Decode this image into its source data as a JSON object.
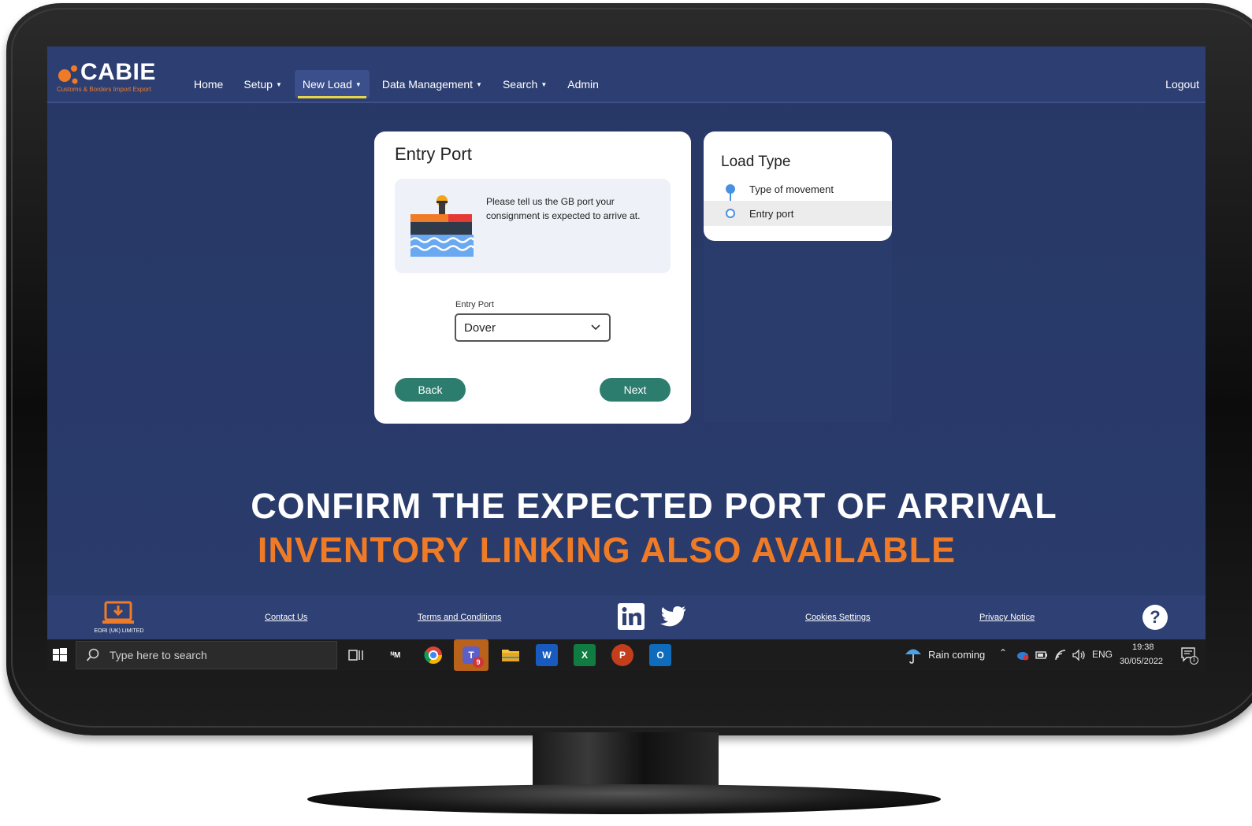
{
  "brand": {
    "name": "CABIE",
    "tagline": "Customs & Borders Import Export",
    "accent": "#f07b27"
  },
  "nav": {
    "items": [
      {
        "label": "Home",
        "has_caret": false
      },
      {
        "label": "Setup",
        "has_caret": true
      },
      {
        "label": "New Load",
        "has_caret": true,
        "active": true
      },
      {
        "label": "Data Management",
        "has_caret": true
      },
      {
        "label": "Search",
        "has_caret": true
      },
      {
        "label": "Admin",
        "has_caret": false
      }
    ],
    "logout": "Logout"
  },
  "entry_card": {
    "title": "Entry Port",
    "info": "Please tell us the GB port your consignment is expected to arrive at.",
    "field_label": "Entry Port",
    "selected_port": "Dover",
    "back_label": "Back",
    "next_label": "Next",
    "button_color": "#2d7d6e"
  },
  "load_type": {
    "title": "Load Type",
    "steps": [
      {
        "label": "Type of movement",
        "state": "done"
      },
      {
        "label": "Entry port",
        "state": "current"
      }
    ]
  },
  "headline": {
    "line1": "CONFIRM THE EXPECTED PORT OF ARRIVAL",
    "line2": "INVENTORY LINKING ALSO AVAILABLE"
  },
  "footer": {
    "company": "EORI (UK) LIMITED",
    "links": {
      "contact": "Contact Us",
      "terms": "Terms and Conditions",
      "cookies": "Cookies Settings",
      "privacy": "Privacy Notice"
    },
    "social": [
      "linkedin-icon",
      "twitter-icon"
    ],
    "help": "?"
  },
  "taskbar": {
    "search_placeholder": "Type here to search",
    "weather": "Rain coming",
    "language": "ENG",
    "time": "19:38",
    "date": "30/05/2022",
    "teams_badge": "9",
    "notification_count": "1"
  }
}
